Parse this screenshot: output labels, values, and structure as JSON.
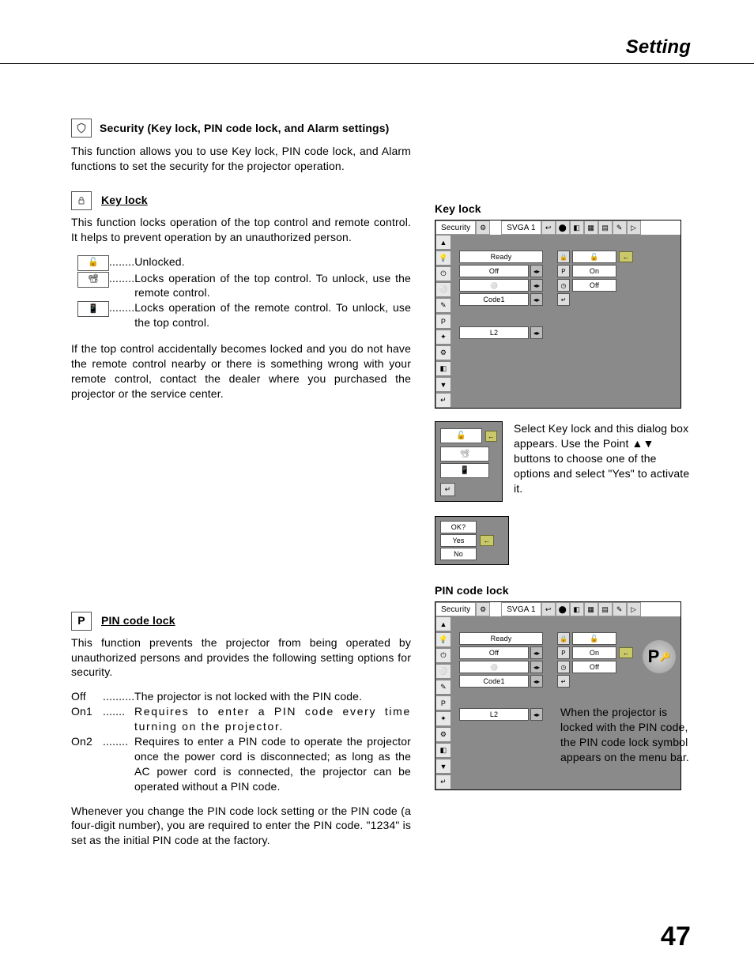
{
  "page": {
    "header": "Setting",
    "number": "47"
  },
  "security": {
    "title": "Security (Key lock, PIN code lock, and Alarm settings)",
    "body": "This function allows you to use Key lock, PIN code lock, and Alarm functions to set the security for the projector operation."
  },
  "keylock": {
    "title": "Key lock",
    "body1": "This function locks operation of the top control and remote control. It helps to prevent operation by an unauthorized person.",
    "opt1": "Unlocked.",
    "opt2": "Locks operation of the top control. To unlock, use the remote control.",
    "opt3": "Locks operation of the remote control. To unlock, use the top control.",
    "body2": "If the top control accidentally becomes locked and you do not have the remote control nearby or there is something wrong with your remote control, contact the dealer where you purchased the projector or the service center.",
    "right_heading": "Key lock",
    "dialog_caption": "Select Key lock and this dialog box appears. Use the Point ▲▼ buttons to choose one of the options and select \"Yes\" to activate it.",
    "confirm": {
      "q": "OK?",
      "yes": "Yes",
      "no": "No"
    }
  },
  "pinlock": {
    "title": "PIN code lock",
    "body1": "This function prevents the projector from being operated by unauthorized persons and provides the following setting options for security.",
    "opt_off_label": "Off",
    "opt_off": "The projector is not locked with the PIN code.",
    "opt_on1_label": "On1",
    "opt_on1": "Requires to enter a PIN code every time turning on the projector.",
    "opt_on2_label": "On2",
    "opt_on2": "Requires to enter a PIN code to operate the projector once the power cord is disconnected; as long as the AC power cord is connected, the projector can be operated without a PIN code.",
    "body2": "Whenever you change the PIN code lock setting or the PIN code (a four-digit number), you are required to enter the PIN code. \"1234\" is set as the initial PIN code at the factory.",
    "right_heading": "PIN code lock",
    "caption": "When the projector is locked with the PIN code, the PIN code lock symbol appears on the menu bar."
  },
  "osd": {
    "tab": "Security",
    "signal": "SVGA 1",
    "items": [
      "Ready",
      "Off",
      "",
      "Code1"
    ],
    "extra": "L2",
    "col2": [
      "",
      "On",
      "Off"
    ],
    "pin_symbol": "P"
  },
  "dots": "........"
}
